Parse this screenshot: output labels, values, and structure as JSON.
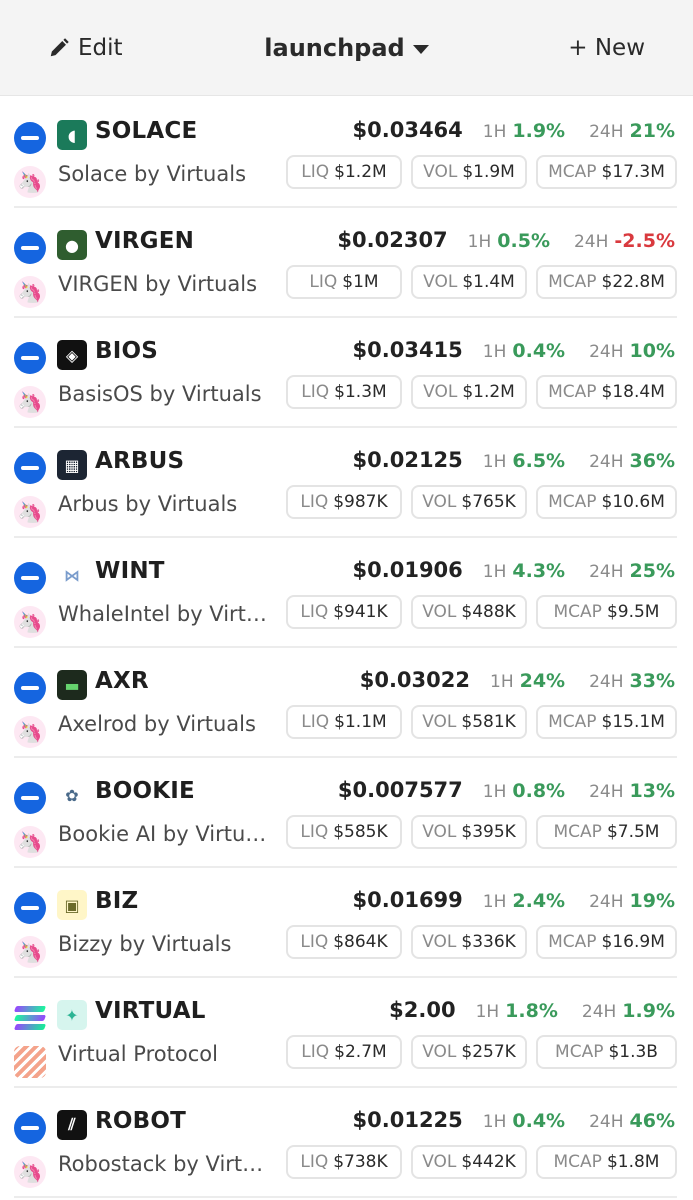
{
  "header": {
    "edit_label": "Edit",
    "title": "launchpad",
    "new_label": "+ New"
  },
  "labels": {
    "h1": "1H",
    "h24": "24H",
    "liq": "LIQ",
    "vol": "VOL",
    "mcap": "MCAP"
  },
  "colors": {
    "positive": "#3a9a5b",
    "negative": "#d9393e",
    "remove_button": "#1565e0",
    "dex_accent": "#ff2e93"
  },
  "tokens": [
    {
      "symbol": "SOLACE",
      "name": "Solace by Virtuals",
      "price": "$0.03464",
      "h1": "1.9%",
      "h24": "21%",
      "h24_dir": "up",
      "liq": "$1.2M",
      "vol": "$1.9M",
      "mcap": "$17.3M",
      "icon": "solace-logo-icon",
      "chain": "remove",
      "dex": "uniswap"
    },
    {
      "symbol": "VIRGEN",
      "name": "VIRGEN by Virtuals",
      "price": "$0.02307",
      "h1": "0.5%",
      "h24": "-2.5%",
      "h24_dir": "down",
      "liq": "$1M",
      "vol": "$1.4M",
      "mcap": "$22.8M",
      "icon": "virgen-logo-icon",
      "chain": "remove",
      "dex": "uniswap"
    },
    {
      "symbol": "BIOS",
      "name": "BasisOS by Virtuals",
      "price": "$0.03415",
      "h1": "0.4%",
      "h24": "10%",
      "h24_dir": "up",
      "liq": "$1.3M",
      "vol": "$1.2M",
      "mcap": "$18.4M",
      "icon": "bios-logo-icon",
      "chain": "remove",
      "dex": "uniswap"
    },
    {
      "symbol": "ARBUS",
      "name": "Arbus by Virtuals",
      "price": "$0.02125",
      "h1": "6.5%",
      "h24": "36%",
      "h24_dir": "up",
      "liq": "$987K",
      "vol": "$765K",
      "mcap": "$10.6M",
      "icon": "arbus-logo-icon",
      "chain": "remove",
      "dex": "uniswap"
    },
    {
      "symbol": "WINT",
      "name": "WhaleIntel by Virtuals",
      "price": "$0.01906",
      "h1": "4.3%",
      "h24": "25%",
      "h24_dir": "up",
      "liq": "$941K",
      "vol": "$488K",
      "mcap": "$9.5M",
      "icon": "wint-logo-icon",
      "chain": "remove",
      "dex": "uniswap"
    },
    {
      "symbol": "AXR",
      "name": "Axelrod by Virtuals",
      "price": "$0.03022",
      "h1": "24%",
      "h24": "33%",
      "h24_dir": "up",
      "liq": "$1.1M",
      "vol": "$581K",
      "mcap": "$15.1M",
      "icon": "axr-logo-icon",
      "chain": "remove",
      "dex": "uniswap"
    },
    {
      "symbol": "BOOKIE",
      "name": "Bookie AI by Virtuals",
      "price": "$0.007577",
      "h1": "0.8%",
      "h24": "13%",
      "h24_dir": "up",
      "liq": "$585K",
      "vol": "$395K",
      "mcap": "$7.5M",
      "icon": "bookie-logo-icon",
      "chain": "remove",
      "dex": "uniswap"
    },
    {
      "symbol": "BIZ",
      "name": "Bizzy by Virtuals",
      "price": "$0.01699",
      "h1": "2.4%",
      "h24": "19%",
      "h24_dir": "up",
      "liq": "$864K",
      "vol": "$336K",
      "mcap": "$16.9M",
      "icon": "biz-logo-icon",
      "chain": "remove",
      "dex": "uniswap"
    },
    {
      "symbol": "VIRTUAL",
      "name": "Virtual Protocol",
      "price": "$2.00",
      "h1": "1.8%",
      "h24": "1.9%",
      "h24_dir": "up",
      "liq": "$2.7M",
      "vol": "$257K",
      "mcap": "$1.3B",
      "icon": "virtual-logo-icon",
      "chain": "solana",
      "dex": "striped"
    },
    {
      "symbol": "ROBOT",
      "name": "Robostack by Virtuals",
      "price": "$0.01225",
      "h1": "0.4%",
      "h24": "46%",
      "h24_dir": "up",
      "liq": "$738K",
      "vol": "$442K",
      "mcap": "$1.8M",
      "icon": "robot-logo-icon",
      "chain": "remove",
      "dex": "uniswap"
    }
  ]
}
